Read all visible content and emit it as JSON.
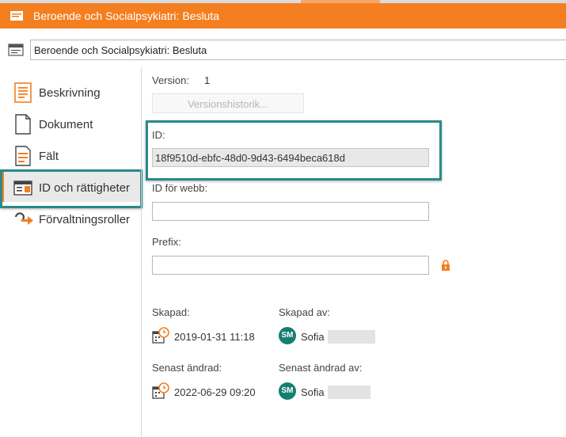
{
  "window": {
    "title": "Beroende och Socialpsykiatri: Besluta"
  },
  "name_field": {
    "value": "Beroende och Socialpsykiatri: Besluta"
  },
  "sidebar": {
    "items": [
      {
        "label": "Beskrivning",
        "icon": "description-icon",
        "active": false
      },
      {
        "label": "Dokument",
        "icon": "document-icon",
        "active": false
      },
      {
        "label": "Fält",
        "icon": "fields-icon",
        "active": false
      },
      {
        "label": "ID och rättigheter",
        "icon": "id-card-icon",
        "active": true
      },
      {
        "label": "Förvaltningsroller",
        "icon": "role-arrow-icon",
        "active": false
      }
    ]
  },
  "details": {
    "version_label": "Version:",
    "version_value": "1",
    "version_history_button": "Versionshistorik...",
    "id_label": "ID:",
    "id_value": "18f9510d-ebfc-48d0-9d43-6494beca618d",
    "web_id_label": "ID för webb:",
    "web_id_value": "",
    "prefix_label": "Prefix:",
    "prefix_value": ""
  },
  "meta": {
    "created_label": "Skapad:",
    "created_value": "2019-01-31 11:18",
    "created_by_label": "Skapad av:",
    "created_by_initials": "SM",
    "created_by_name": "Sofia",
    "modified_label": "Senast ändrad:",
    "modified_value": "2022-06-29 09:20",
    "modified_by_label": "Senast ändrad av:",
    "modified_by_initials": "SM",
    "modified_by_name": "Sofia"
  },
  "colors": {
    "accent": "#f47f20",
    "highlight": "#2a8a8a",
    "avatar": "#177e72"
  }
}
